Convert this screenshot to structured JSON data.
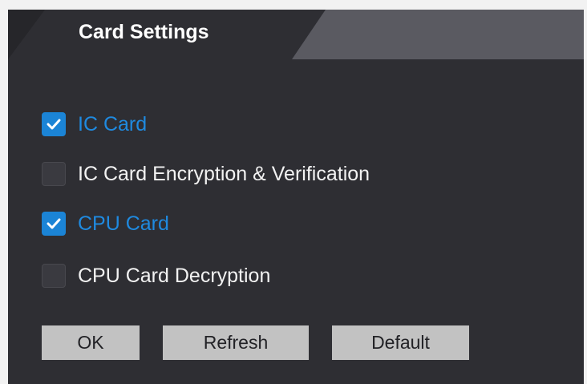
{
  "tab": {
    "title": "Card Settings"
  },
  "options": [
    {
      "label": "IC Card",
      "checked": true
    },
    {
      "label": "IC Card Encryption & Verification",
      "checked": false
    },
    {
      "label": "CPU Card",
      "checked": true
    },
    {
      "label": "CPU Card Decryption",
      "checked": false
    }
  ],
  "buttons": {
    "ok": "OK",
    "refresh": "Refresh",
    "default": "Default"
  },
  "colors": {
    "panel_bg": "#2e2e33",
    "tab_strip_bg": "#5a5a61",
    "accent_blue": "#1b84d6",
    "button_bg": "#c2c2c2"
  },
  "icons": {
    "checkbox_checked": "checkmark-icon"
  }
}
